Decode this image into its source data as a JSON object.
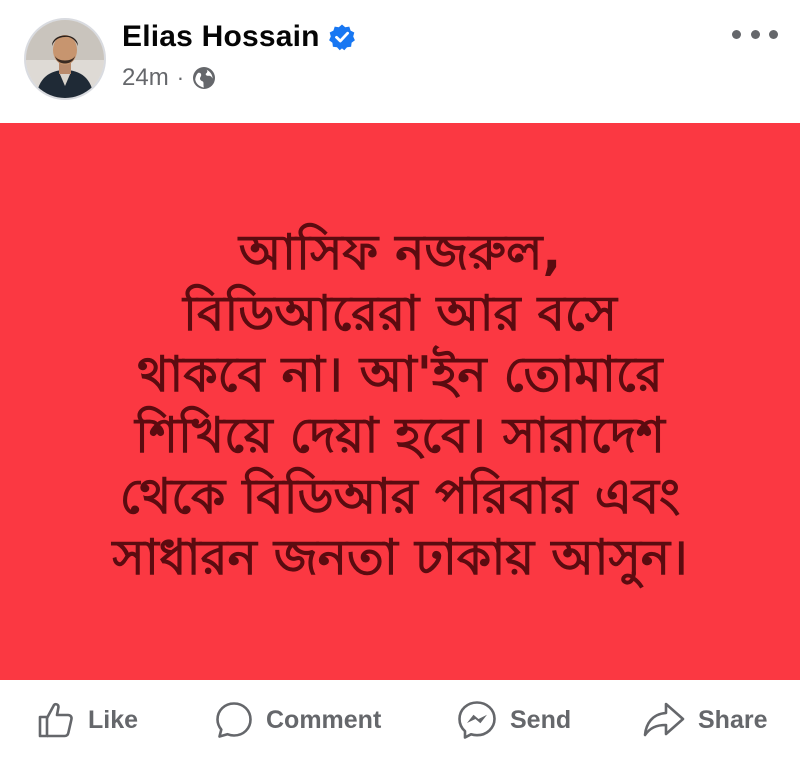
{
  "post": {
    "author": {
      "name": "Elias Hossain",
      "verified": true,
      "time": "24m",
      "separator": "·",
      "audience_icon": "globe-icon"
    },
    "more_icon": "more-options-icon",
    "background_color": "#fb3842",
    "text_color": "#5b0b10",
    "lines": [
      "আসিফ নজরুল,",
      "বিডিআরেরা আর বসে",
      "থাকবে না। আ'ইন তোমারে",
      "শিখিয়ে দেয়া হবে। সারাদেশ",
      "থেকে বিডিআর পরিবার এবং",
      "সাধারন জনতা ঢাকায় আসুন।"
    ]
  },
  "actions": {
    "like": {
      "label": "Like",
      "icon": "thumbs-up-icon"
    },
    "comment": {
      "label": "Comment",
      "icon": "comment-icon"
    },
    "send": {
      "label": "Send",
      "icon": "messenger-icon"
    },
    "share": {
      "label": "Share",
      "icon": "share-icon"
    }
  },
  "colors": {
    "verified_badge": "#1877f2",
    "secondary_text": "#65676b"
  }
}
